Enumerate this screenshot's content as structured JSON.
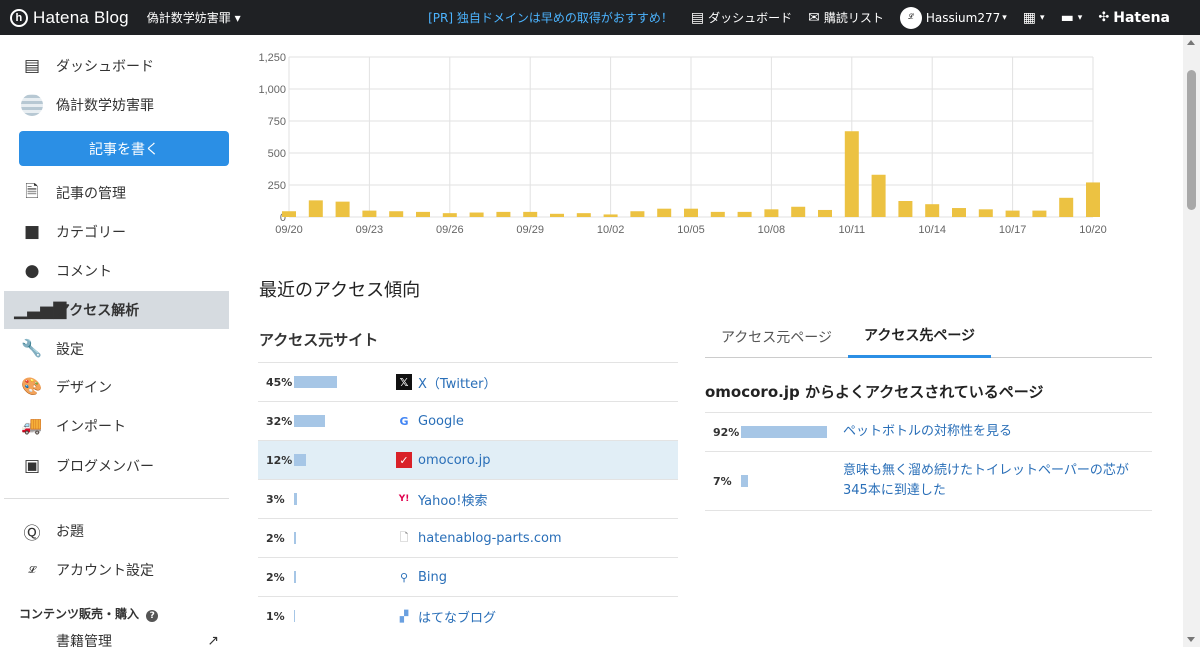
{
  "topbar": {
    "logo_text": "Hatena Blog",
    "blog_selector": "偽計数学妨害罪",
    "pr_text": "[PR] 独自ドメインは早めの取得がおすすめ！",
    "dashboard_label": "ダッシュボード",
    "reading_list_label": "購読リスト",
    "user_name": "Hassium277",
    "hatena_label": "Hatena"
  },
  "sidebar": {
    "items": [
      {
        "label": "ダッシュボード",
        "icon": "dashboard-icon"
      },
      {
        "label": "偽計数学妨害罪",
        "icon": "blog-icon"
      },
      {
        "label": "記事の管理",
        "icon": "document-icon"
      },
      {
        "label": "カテゴリー",
        "icon": "folder-icon"
      },
      {
        "label": "コメント",
        "icon": "comment-icon"
      },
      {
        "label": "アクセス解析",
        "icon": "signal-icon"
      },
      {
        "label": "設定",
        "icon": "wrench-icon"
      },
      {
        "label": "デザイン",
        "icon": "palette-icon"
      },
      {
        "label": "インポート",
        "icon": "truck-icon"
      },
      {
        "label": "ブログメンバー",
        "icon": "member-icon"
      },
      {
        "label": "お題",
        "icon": "question-icon"
      },
      {
        "label": "アカウント設定",
        "icon": "signature-icon"
      }
    ],
    "write_button": "記事を書く",
    "section_heading": "コンテンツ販売・購入",
    "cut_item": "書籍管理"
  },
  "chart_data": {
    "type": "bar",
    "x": [
      "09/20",
      "09/21",
      "09/22",
      "09/23",
      "09/24",
      "09/25",
      "09/26",
      "09/27",
      "09/28",
      "09/29",
      "09/30",
      "10/01",
      "10/02",
      "10/03",
      "10/04",
      "10/05",
      "10/06",
      "10/07",
      "10/08",
      "10/09",
      "10/10",
      "10/11",
      "10/12",
      "10/13",
      "10/14",
      "10/15",
      "10/16",
      "10/17",
      "10/18",
      "10/19",
      "10/20"
    ],
    "values": [
      45,
      130,
      120,
      50,
      45,
      40,
      30,
      35,
      40,
      40,
      25,
      30,
      20,
      45,
      65,
      65,
      40,
      40,
      60,
      80,
      55,
      670,
      330,
      125,
      100,
      70,
      60,
      50,
      50,
      150,
      270
    ],
    "tick_labels": [
      "09/20",
      "09/23",
      "09/26",
      "09/29",
      "10/02",
      "10/05",
      "10/08",
      "10/11",
      "10/14",
      "10/17",
      "10/20"
    ],
    "y_ticks": [
      "0",
      "250",
      "500",
      "750",
      "1,000",
      "1,250"
    ],
    "ylim": [
      0,
      1250
    ],
    "grid": true,
    "color": "#ecc242"
  },
  "main": {
    "section_title": "最近のアクセス傾向",
    "referrers_title": "アクセス元サイト",
    "referrers": [
      {
        "pct": "45%",
        "value": 45,
        "name": "X（Twitter）",
        "icon": "x-icon"
      },
      {
        "pct": "32%",
        "value": 32,
        "name": "Google",
        "icon": "google-icon"
      },
      {
        "pct": "12%",
        "value": 12,
        "name": "omocoro.jp",
        "icon": "omocoro-icon"
      },
      {
        "pct": "3%",
        "value": 3,
        "name": "Yahoo!検索",
        "icon": "yahoo-icon"
      },
      {
        "pct": "2%",
        "value": 2,
        "name": "hatenablog-parts.com",
        "icon": "page-icon"
      },
      {
        "pct": "2%",
        "value": 2,
        "name": "Bing",
        "icon": "bing-icon"
      },
      {
        "pct": "1%",
        "value": 1,
        "name": "はてなブログ",
        "icon": "hatenablog-icon"
      }
    ],
    "tabs": [
      "アクセス元ページ",
      "アクセス先ページ"
    ],
    "active_tab": 1,
    "landing_title": "omocoro.jp からよくアクセスされているページ",
    "landing_pages": [
      {
        "pct": "92%",
        "value": 92,
        "title": "ペットボトルの対称性を見る"
      },
      {
        "pct": "7%",
        "value": 7,
        "title": "意味も無く溜め続けたトイレットペーパーの芯が345本に到達した"
      }
    ]
  }
}
